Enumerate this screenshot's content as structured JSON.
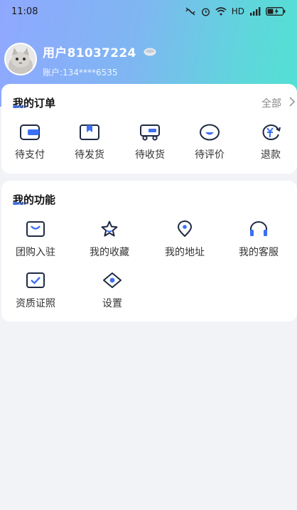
{
  "status_bar": {
    "time": "11:08",
    "network": "HD"
  },
  "profile": {
    "username": "用户81037224",
    "account": "账户:134****6535"
  },
  "orders": {
    "title": "我的订单",
    "all_label": "全部",
    "items": [
      {
        "label": "待支付",
        "icon": "wallet-icon"
      },
      {
        "label": "待发货",
        "icon": "bookmark-box-icon"
      },
      {
        "label": "待收货",
        "icon": "truck-icon"
      },
      {
        "label": "待评价",
        "icon": "smile-icon"
      },
      {
        "label": "退款",
        "icon": "refund-icon"
      }
    ]
  },
  "features": {
    "title": "我的功能",
    "items": [
      {
        "label": "团购入驻",
        "icon": "bag-icon"
      },
      {
        "label": "我的收藏",
        "icon": "star-icon"
      },
      {
        "label": "我的地址",
        "icon": "location-icon"
      },
      {
        "label": "我的客服",
        "icon": "headset-icon"
      },
      {
        "label": "资质证照",
        "icon": "certificate-icon"
      },
      {
        "label": "设置",
        "icon": "eye-settings-icon"
      }
    ]
  },
  "colors": {
    "accent": "#3b6ff5",
    "icon_stroke": "#1f2a44"
  }
}
